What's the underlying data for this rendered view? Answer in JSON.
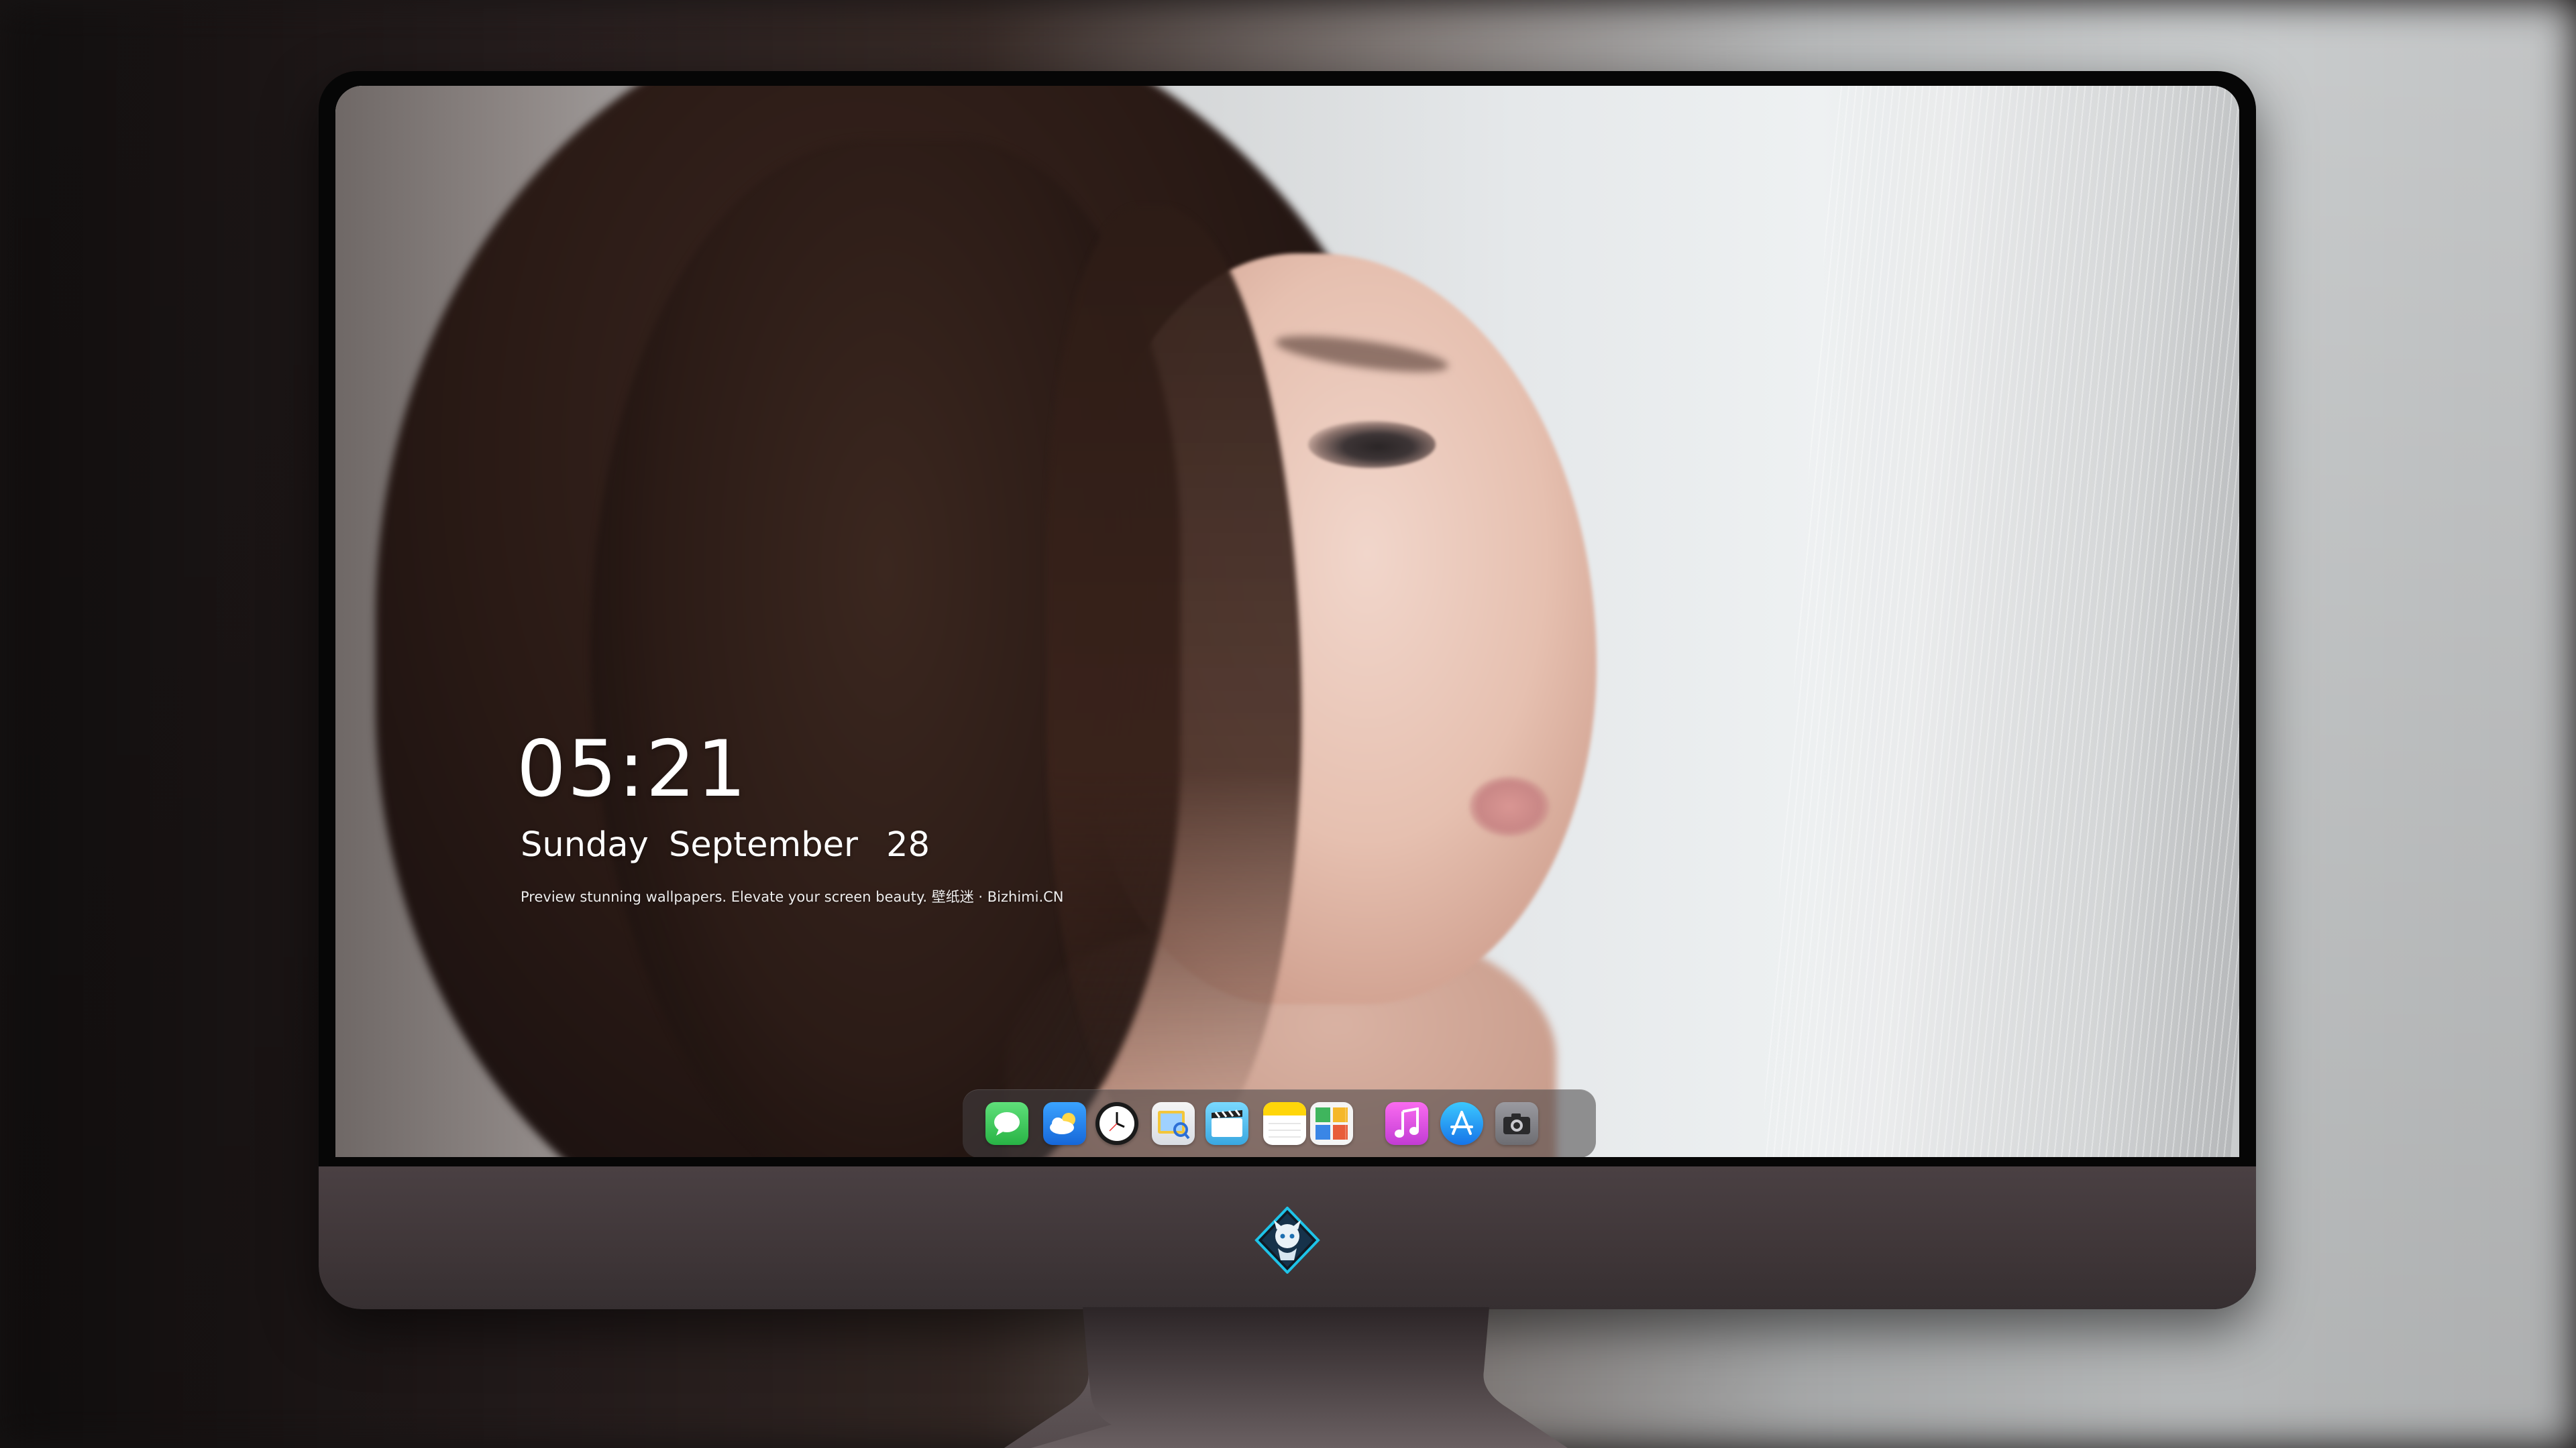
{
  "lockscreen": {
    "time": "05:21",
    "weekday": "Sunday",
    "month": "September",
    "day": "28",
    "caption": "Preview stunning wallpapers. Elevate your screen beauty. 壁纸迷 · Bizhimi.CN"
  },
  "dock": {
    "apps": [
      {
        "name": "messages-icon",
        "color": "#34c759"
      },
      {
        "name": "weather-icon",
        "color": "#1e90ff"
      },
      {
        "name": "clock-icon",
        "color": "#ffffff"
      },
      {
        "name": "preview-icon",
        "color": "#4a90e2"
      },
      {
        "name": "video-editor-icon",
        "color": "#5ac8fa"
      },
      {
        "name": "notes-icon",
        "color": "#ffd60a"
      },
      {
        "name": "photo-booth-icon",
        "color": "#e85d3a"
      },
      {
        "name": "music-icon",
        "color": "#e94ef0"
      },
      {
        "name": "app-store-icon",
        "color": "#1c9bf0"
      },
      {
        "name": "camera-icon",
        "color": "#8e8e93"
      }
    ]
  },
  "colors": {
    "frame": "#060606",
    "chin": "#3f3638",
    "text": "#ffffff"
  }
}
